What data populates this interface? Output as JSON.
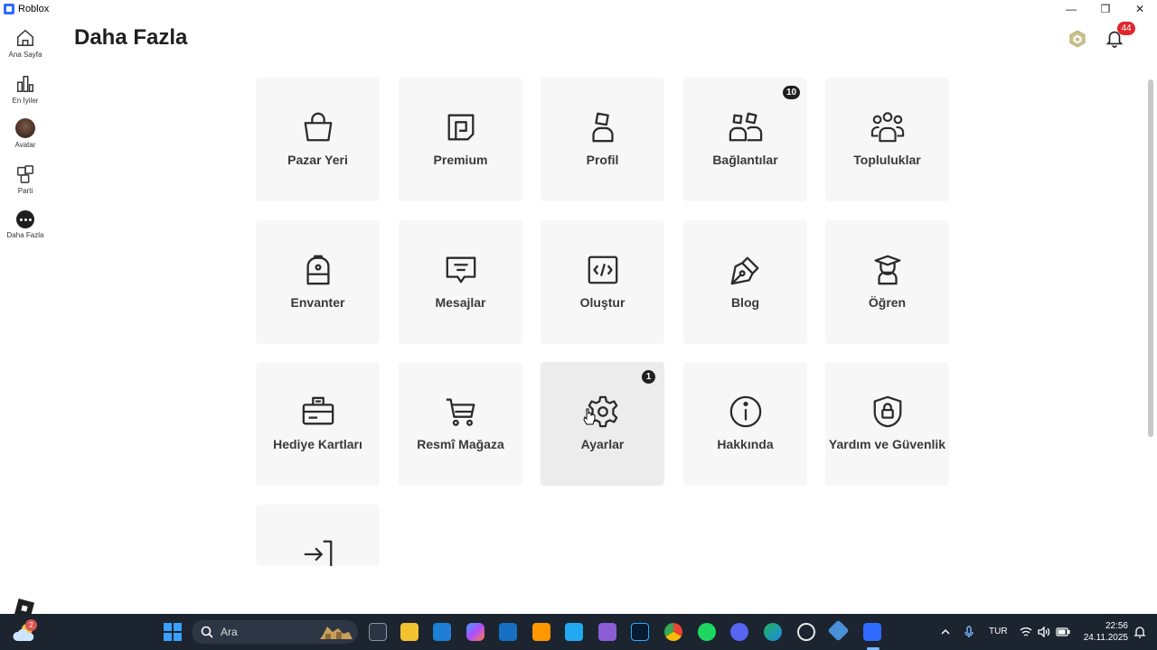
{
  "window": {
    "title": "Roblox",
    "minimize": "—",
    "maximize": "❐",
    "close": "✕"
  },
  "sidebar": {
    "items": [
      {
        "label": "Ana Sayfa"
      },
      {
        "label": "En İyiler"
      },
      {
        "label": "Avatar"
      },
      {
        "label": "Parti"
      },
      {
        "label": "Daha Fazla"
      }
    ]
  },
  "header": {
    "title": "Daha Fazla",
    "notifications_count": "44"
  },
  "tiles": [
    {
      "label": "Pazar Yeri",
      "icon": "shopping-bag-icon"
    },
    {
      "label": "Premium",
      "icon": "premium-icon"
    },
    {
      "label": "Profil",
      "icon": "profile-icon"
    },
    {
      "label": "Bağlantılar",
      "icon": "connections-icon",
      "badge": "10"
    },
    {
      "label": "Topluluklar",
      "icon": "communities-icon"
    },
    {
      "label": "Envanter",
      "icon": "backpack-icon"
    },
    {
      "label": "Mesajlar",
      "icon": "message-icon"
    },
    {
      "label": "Oluştur",
      "icon": "code-icon"
    },
    {
      "label": "Blog",
      "icon": "pen-icon"
    },
    {
      "label": "Öğren",
      "icon": "graduation-icon"
    },
    {
      "label": "Hediye Kartları",
      "icon": "gift-card-icon"
    },
    {
      "label": "Resmî Mağaza",
      "icon": "cart-icon"
    },
    {
      "label": "Ayarlar",
      "icon": "gear-icon",
      "badge": "1"
    },
    {
      "label": "Hakkında",
      "icon": "info-icon"
    },
    {
      "label": "Yardım ve Güvenlik",
      "icon": "shield-lock-icon"
    },
    {
      "label": "",
      "icon": "logout-icon"
    }
  ],
  "taskbar": {
    "weather_badge": "2",
    "search_placeholder": "Ara",
    "language": "TUR",
    "time": "22:56",
    "date": "24.11.2025"
  },
  "colors": {
    "accent_blue": "#2f6bff",
    "notification_red": "#e0262c",
    "tile_bg": "#f7f7f7"
  }
}
